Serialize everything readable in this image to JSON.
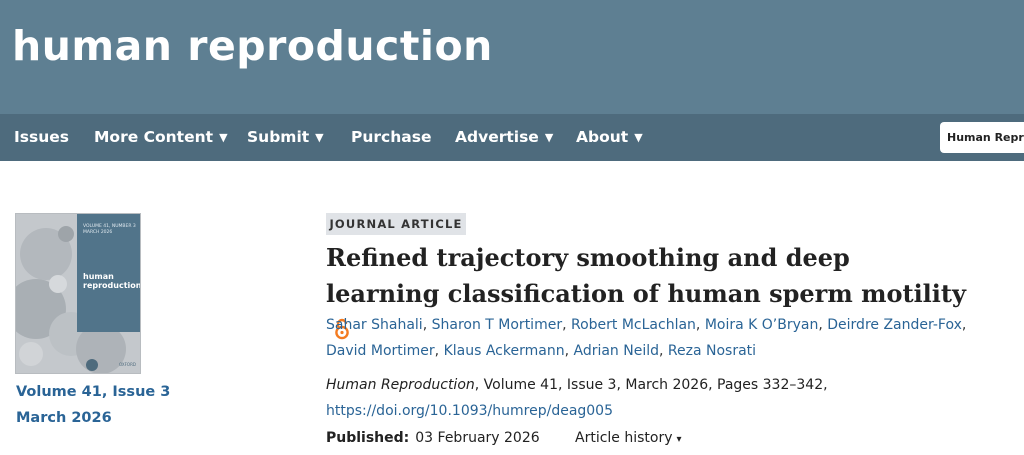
{
  "site": {
    "title": "human reproduction"
  },
  "nav": {
    "items": [
      {
        "label": "Issues",
        "caret": ""
      },
      {
        "label": "More Content",
        "caret": "▼"
      },
      {
        "label": "Submit",
        "caret": "▼"
      },
      {
        "label": "Purchase",
        "caret": ""
      },
      {
        "label": "Advertise",
        "caret": "▼"
      },
      {
        "label": "About",
        "caret": "▼"
      }
    ],
    "search_scope": "Human Reproduction"
  },
  "issue": {
    "cover_volume_text": "VOLUME 41, NUMBER 3  MARCH 2026",
    "cover_title": "human reproduction",
    "cover_publisher": "OXFORD",
    "volume_issue": "Volume 41, Issue 3",
    "date": "March 2026"
  },
  "article": {
    "type": "JOURNAL ARTICLE",
    "title": "Refined trajectory smoothing and deep learning classification of human sperm motility",
    "open_access_icon": "open-access-icon",
    "authors": [
      "Sahar Shahali",
      "Sharon T Mortimer",
      "Robert McLachlan",
      "Moira K O’Bryan",
      "Deirdre Zander-Fox",
      "David Mortimer",
      "Klaus Ackermann",
      "Adrian Neild",
      "Reza Nosrati"
    ],
    "citation": {
      "journal": "Human Reproduction",
      "details": ", Volume 41, Issue 3, March 2026, Pages 332–342,"
    },
    "doi": "https://doi.org/10.1093/humrep/deag005",
    "published_label": "Published:",
    "published_date": "03 February 2026",
    "history_label": "Article history",
    "history_caret": "▾"
  },
  "colors": {
    "banner": "#5e7f92",
    "navbar": "#4e6b7d",
    "link": "#2a6496",
    "open_access": "#f47b20"
  }
}
